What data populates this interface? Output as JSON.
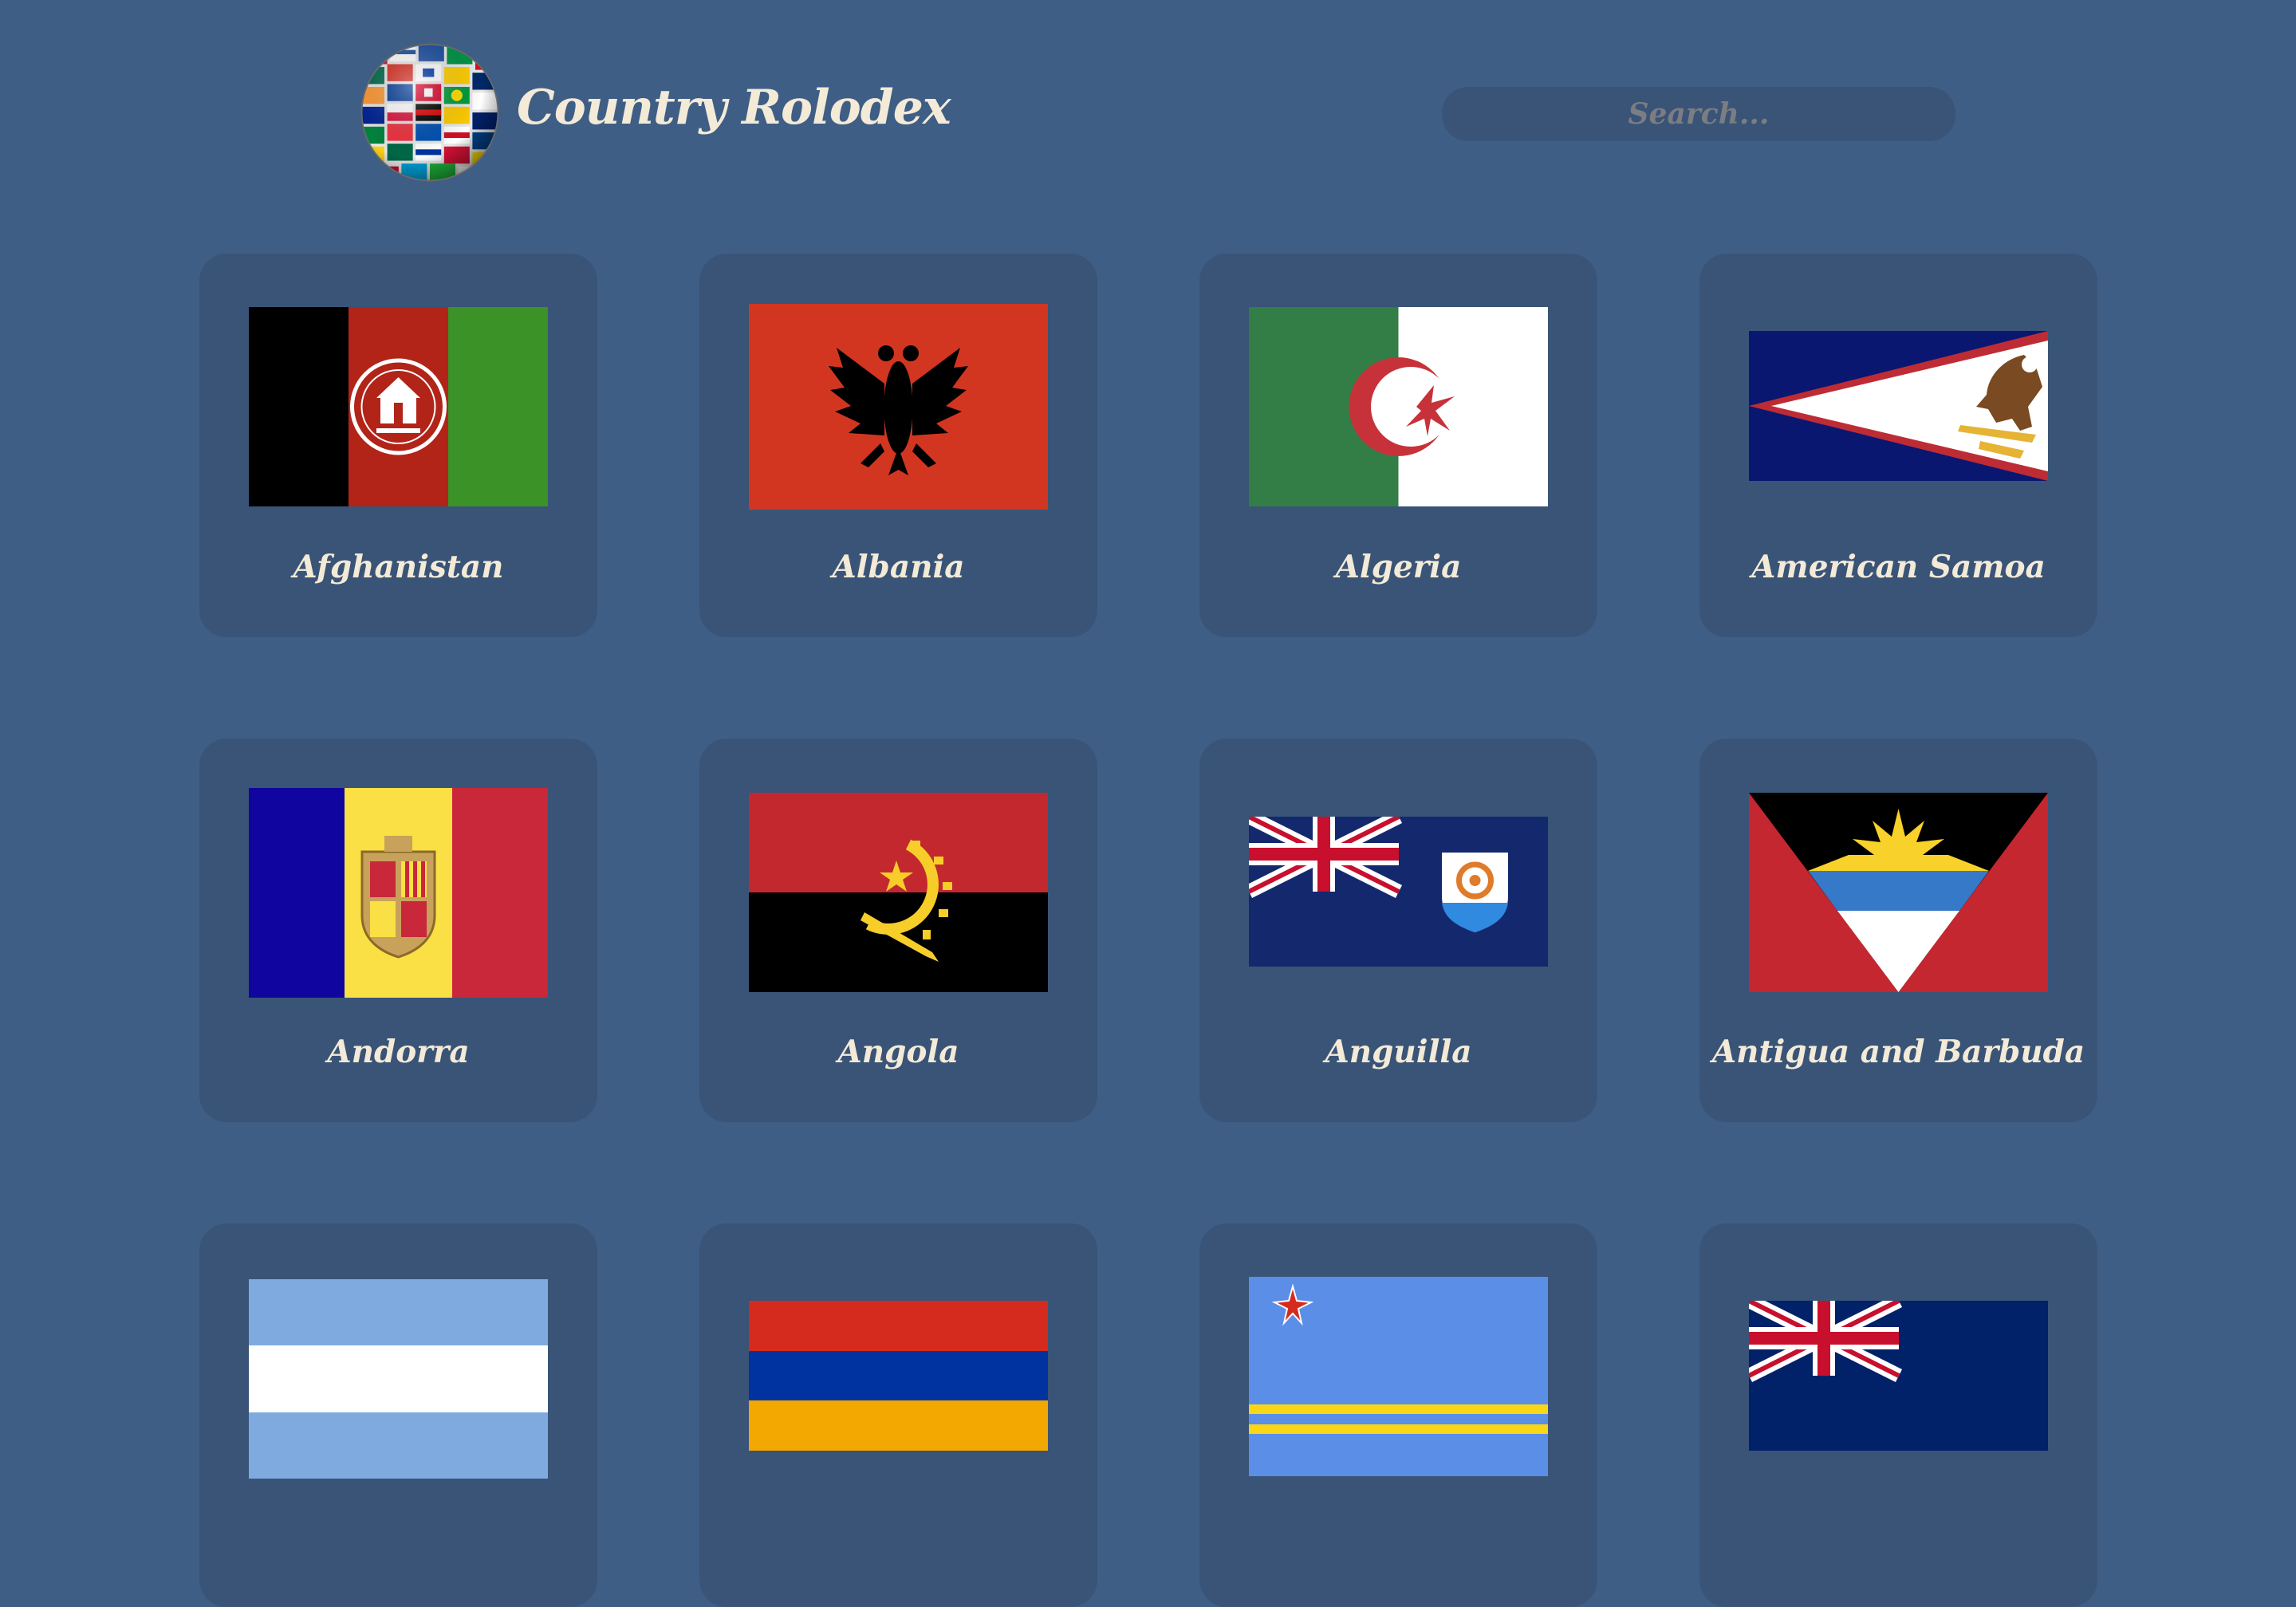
{
  "header": {
    "app_title": "Country Rolodex",
    "search_placeholder": "Search..."
  },
  "countries": [
    {
      "name": "Afghanistan"
    },
    {
      "name": "Albania"
    },
    {
      "name": "Algeria"
    },
    {
      "name": "American Samoa"
    },
    {
      "name": "Andorra"
    },
    {
      "name": "Angola"
    },
    {
      "name": "Anguilla"
    },
    {
      "name": "Antigua and Barbuda"
    },
    {
      "name": ""
    },
    {
      "name": ""
    },
    {
      "name": ""
    },
    {
      "name": ""
    }
  ],
  "colors": {
    "background": "#3f5e85",
    "card": "#395477",
    "text": "#f3ead7",
    "placeholder": "#7b7d83"
  }
}
